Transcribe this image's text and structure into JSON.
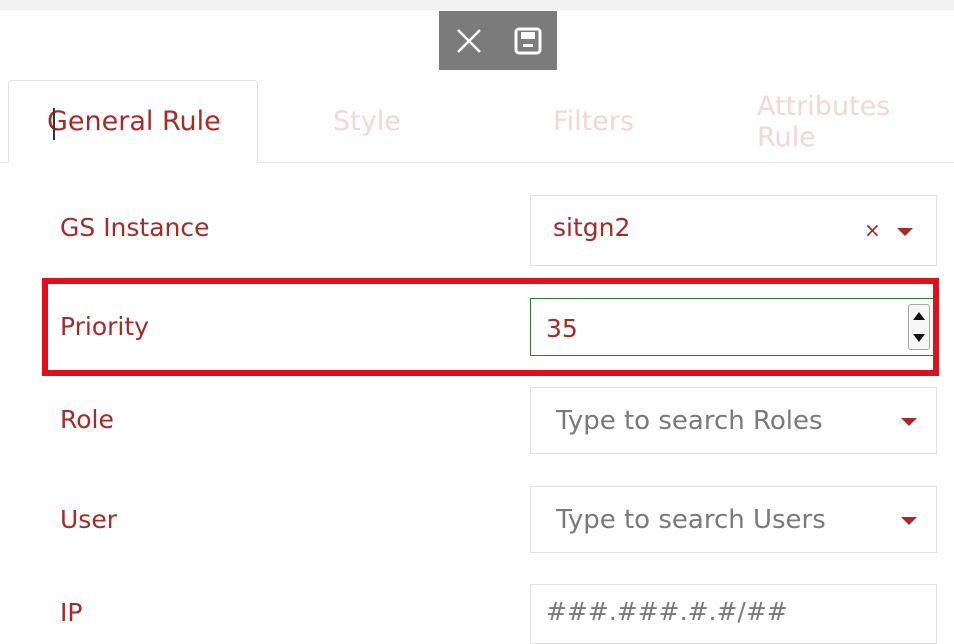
{
  "toolbar": {
    "close_icon": "close-icon",
    "save_icon": "save-icon"
  },
  "tabs": [
    {
      "label": "General Rule",
      "active": true
    },
    {
      "label": "Style",
      "active": false
    },
    {
      "label": "Filters",
      "active": false
    },
    {
      "label": "Attributes Rule",
      "active": false
    }
  ],
  "form": {
    "gs_instance": {
      "label": "GS Instance",
      "value": "sitgn2",
      "clear_symbol": "×"
    },
    "priority": {
      "label": "Priority",
      "value": "35"
    },
    "role": {
      "label": "Role",
      "placeholder": "Type to search Roles"
    },
    "user": {
      "label": "User",
      "placeholder": "Type to search Users"
    },
    "ip": {
      "label": "IP",
      "placeholder": "###.###.#.#/##"
    }
  },
  "colors": {
    "accent": "#a52a2a",
    "highlight": "#e0101b",
    "toolbar": "#7b7b7b",
    "focus_border": "#2e7d32"
  }
}
